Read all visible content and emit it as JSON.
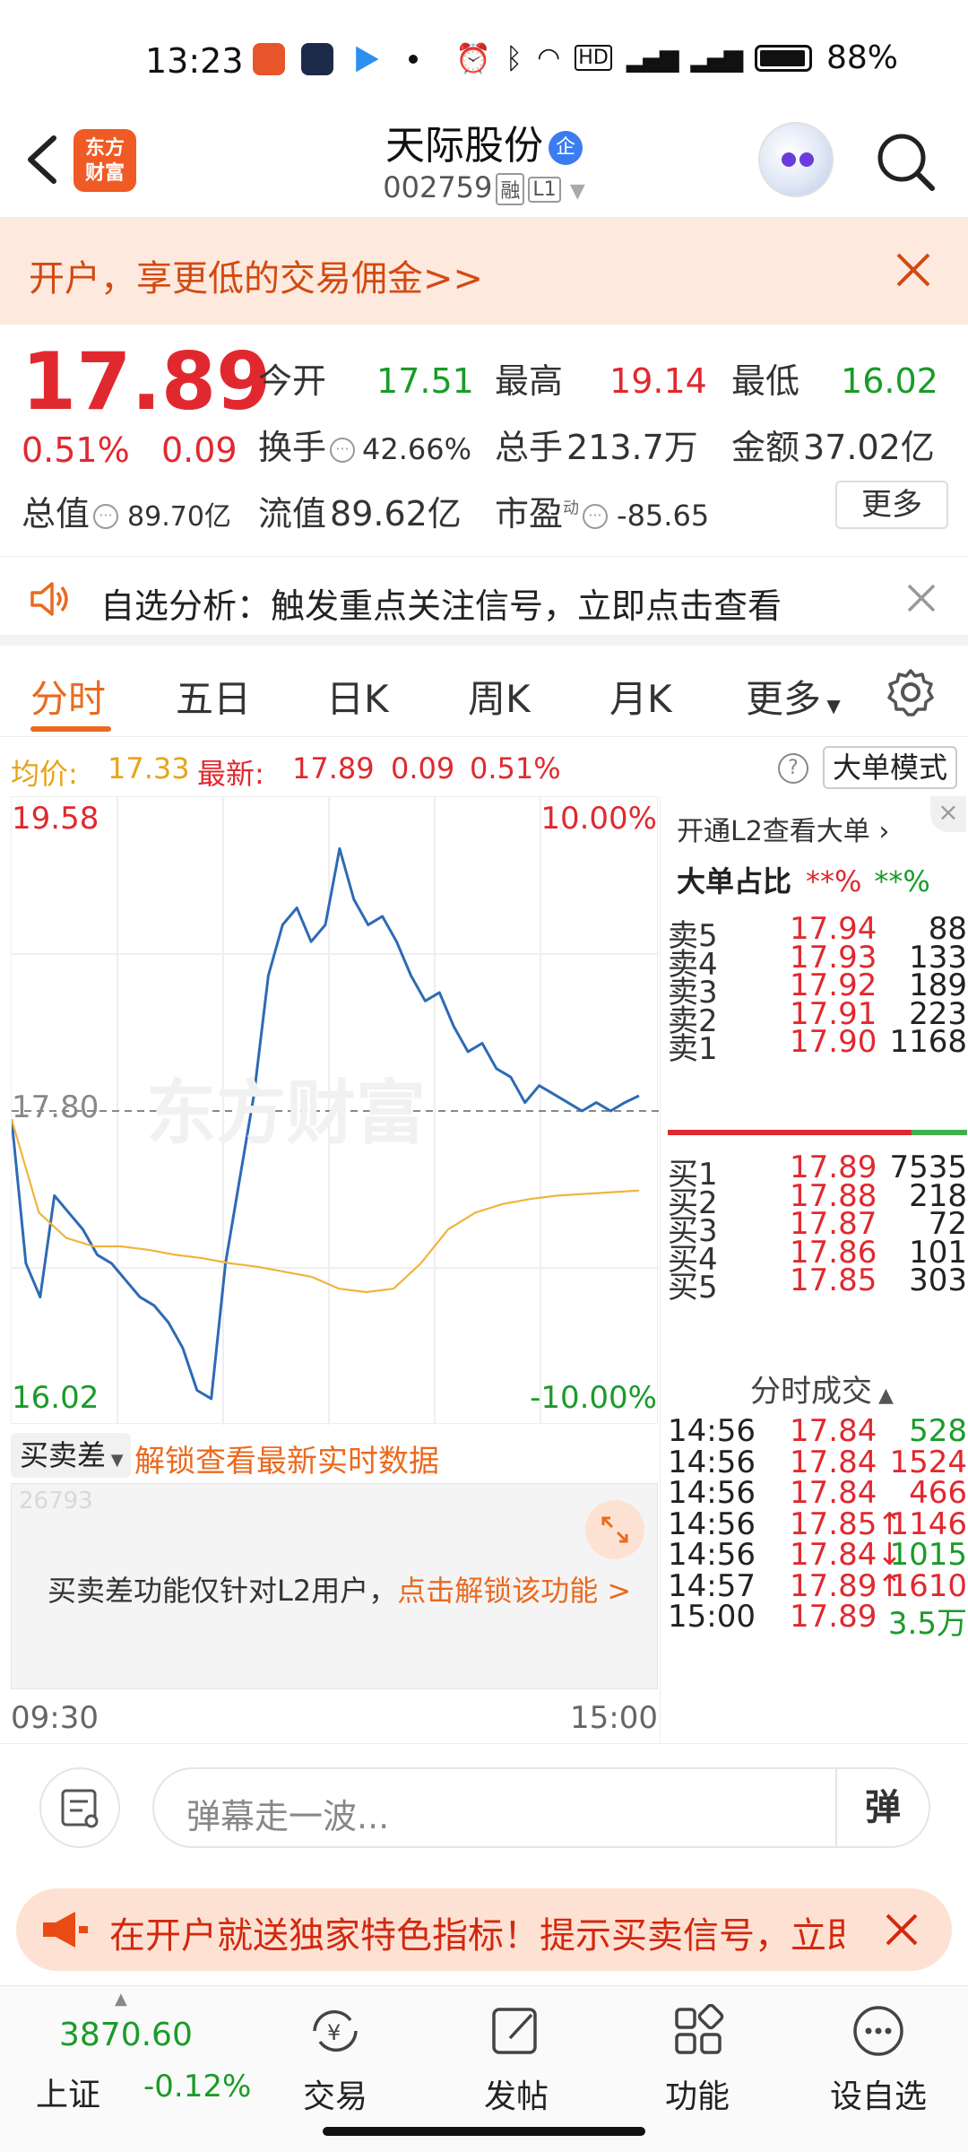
{
  "status_bar": {
    "time": "13:23",
    "battery": "88%"
  },
  "header": {
    "logo_text": "东方财富",
    "stock_name": "天际股份",
    "badge": "企",
    "stock_code": "002759",
    "tag_margin": "融",
    "tag_level": "L1"
  },
  "promo": {
    "text": "开户，享更低的交易佣金>>"
  },
  "quote": {
    "price": "17.89",
    "change_pct": "0.51%",
    "change_amt": "0.09",
    "open_label": "今开",
    "open": "17.51",
    "high_label": "最高",
    "high": "19.14",
    "low_label": "最低",
    "low": "16.02",
    "turnover_label": "换手",
    "turnover": "42.66%",
    "volume_label": "总手",
    "volume": "213.7万",
    "amount_label": "金额",
    "amount": "37.02亿",
    "mcap_label": "总值",
    "mcap": "89.70亿",
    "float_label": "流值",
    "float": "89.62亿",
    "pe_label": "市盈",
    "pe_sup": "动",
    "pe": "-85.65",
    "more": "更多"
  },
  "analysis": {
    "text": "自选分析：触发重点关注信号，立即点击查看"
  },
  "tabs": [
    "分时",
    "五日",
    "日K",
    "周K",
    "月K",
    "更多"
  ],
  "avg_row": {
    "avg_label": "均价:",
    "avg": "17.33",
    "latest_label": "最新:",
    "latest": "17.89",
    "chg": "0.09",
    "pct": "0.51%",
    "mode": "大单模式"
  },
  "chart": {
    "top_price": "19.58",
    "top_pct": "10.00%",
    "bottom_price": "16.02",
    "bottom_pct": "-10.00%",
    "ref_price": "17.80",
    "watermark": "东方财富",
    "start_time": "09:30",
    "end_time": "15:00"
  },
  "chart_data": {
    "type": "line",
    "title": "",
    "xlabel": "",
    "ylabel": "",
    "ylim": [
      16.02,
      19.58
    ],
    "x_range": [
      "09:30",
      "15:00"
    ],
    "reference_line": 17.8,
    "series": [
      {
        "values": [
          17.75,
          16.9,
          16.7,
          17.3,
          17.2,
          17.1,
          16.95,
          16.9,
          16.8,
          16.7,
          16.65,
          16.55,
          16.4,
          16.15,
          16.1,
          16.9,
          17.4,
          17.9,
          18.6,
          18.9,
          19.0,
          18.8,
          18.9,
          19.35,
          19.05,
          18.9,
          18.95,
          18.8,
          18.6,
          18.45,
          18.5,
          18.3,
          18.15,
          18.2,
          18.05,
          18.0,
          17.85,
          17.95,
          17.9,
          17.85,
          17.8,
          17.85,
          17.8,
          17.85,
          17.89
        ]
      },
      {
        "values": [
          17.75,
          17.2,
          17.05,
          17.0,
          17.0,
          16.98,
          16.95,
          16.93,
          16.9,
          16.88,
          16.85,
          16.82,
          16.75,
          16.73,
          16.75,
          16.9,
          17.1,
          17.2,
          17.25,
          17.28,
          17.3,
          17.31,
          17.32,
          17.33
        ]
      }
    ]
  },
  "spread": {
    "selector": "买卖差",
    "unlock": "解锁查看最新实时数据",
    "ghost": "26793",
    "msg": "买卖差功能仅针对L2用户，",
    "msg_link": "点击解锁该功能 >"
  },
  "book": {
    "l2_link": "开通L2查看大单",
    "ratio_label": "大单占比",
    "ratio_buy": "**%",
    "ratio_sell": "**%",
    "asks": [
      {
        "label": "卖5",
        "price": "17.94",
        "vol": "88"
      },
      {
        "label": "卖4",
        "price": "17.93",
        "vol": "133"
      },
      {
        "label": "卖3",
        "price": "17.92",
        "vol": "189"
      },
      {
        "label": "卖2",
        "price": "17.91",
        "vol": "223"
      },
      {
        "label": "卖1",
        "price": "17.90",
        "vol": "1168"
      }
    ],
    "bids": [
      {
        "label": "买1",
        "price": "17.89",
        "vol": "7535"
      },
      {
        "label": "买2",
        "price": "17.88",
        "vol": "218"
      },
      {
        "label": "买3",
        "price": "17.87",
        "vol": "72"
      },
      {
        "label": "买4",
        "price": "17.86",
        "vol": "101"
      },
      {
        "label": "买5",
        "price": "17.85",
        "vol": "303"
      }
    ],
    "trades_title": "分时成交",
    "trades": [
      {
        "time": "14:56",
        "price": "17.84",
        "vol": "528",
        "dir": "",
        "color": "#1a9b29"
      },
      {
        "time": "14:56",
        "price": "17.84",
        "vol": "1524",
        "dir": "",
        "color": "#e0292f"
      },
      {
        "time": "14:56",
        "price": "17.84",
        "vol": "466",
        "dir": "",
        "color": "#e0292f"
      },
      {
        "time": "14:56",
        "price": "17.85",
        "vol": "1146",
        "dir": "↑",
        "color": "#e0292f"
      },
      {
        "time": "14:56",
        "price": "17.84",
        "vol": "1015",
        "dir": "↓",
        "color": "#1a9b29"
      },
      {
        "time": "14:57",
        "price": "17.89",
        "vol": "1610",
        "dir": "↑",
        "color": "#e0292f"
      },
      {
        "time": "15:00",
        "price": "17.89",
        "vol": "3.5万",
        "dir": "",
        "color": "#1a9b29"
      }
    ]
  },
  "comment": {
    "placeholder": "弹幕走一波...",
    "danmu": "弹"
  },
  "ad": {
    "text": "在开户就送独家特色指标！提示买卖信号，立即领"
  },
  "bottom_nav": {
    "index_value": "3870.60",
    "index_name": "上证",
    "index_change": "-0.12%",
    "items": [
      "交易",
      "发帖",
      "功能",
      "设自选"
    ]
  }
}
